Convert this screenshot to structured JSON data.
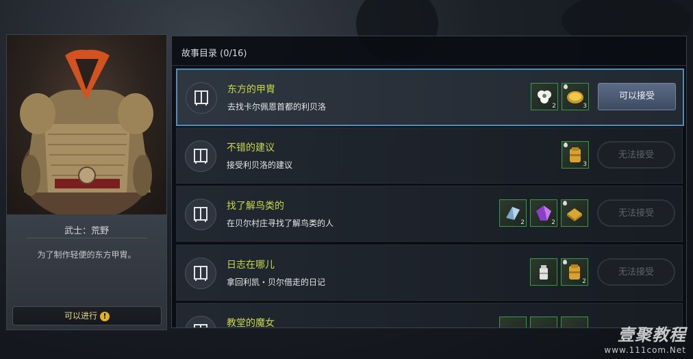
{
  "character": {
    "name": "武士：荒野",
    "description": "为了制作轻便的东方甲胄。",
    "status_button": "可以进行",
    "status_icon": "!"
  },
  "story": {
    "header": "故事目录 (0/16)",
    "quests": [
      {
        "title": "东方的甲胄",
        "subtitle": "去找卡尔佩恩首都的利贝洛",
        "selected": true,
        "button": "可以接受",
        "button_state": "enabled",
        "rewards": [
          {
            "icon": "cotton-icon",
            "count": "2"
          },
          {
            "icon": "gold-disc-icon",
            "count": "3"
          }
        ]
      },
      {
        "title": "不错的建议",
        "subtitle": "接受利贝洛的建议",
        "selected": false,
        "button": "无法接受",
        "button_state": "disabled",
        "rewards": [
          {
            "icon": "gold-pack-icon",
            "count": "3"
          }
        ]
      },
      {
        "title": "找了解鸟类的",
        "subtitle": "在贝尔村庄寻找了解鸟类的人",
        "selected": false,
        "button": "无法接受",
        "button_state": "disabled",
        "rewards": [
          {
            "icon": "crystal-shard-icon",
            "count": "2"
          },
          {
            "icon": "purple-gem-icon",
            "count": "2"
          },
          {
            "icon": "gold-chest-icon",
            "count": ""
          }
        ]
      },
      {
        "title": "日志在哪儿",
        "subtitle": "拿回利凯・贝尔借走的日记",
        "selected": false,
        "button": "无法接受",
        "button_state": "disabled",
        "rewards": [
          {
            "icon": "milk-can-icon",
            "count": ""
          },
          {
            "icon": "gold-pack-icon",
            "count": "2"
          }
        ]
      },
      {
        "title": "教堂的魔女",
        "subtitle": "",
        "selected": false,
        "button": "",
        "button_state": "disabled",
        "rewards": []
      }
    ]
  },
  "watermark": {
    "title": "壹聚教程",
    "url": "www.111com.Net"
  },
  "colors": {
    "quest_title": "#c9d84a",
    "selected_border": "#4f8fb8",
    "reward_border": "#3c9a4a"
  }
}
